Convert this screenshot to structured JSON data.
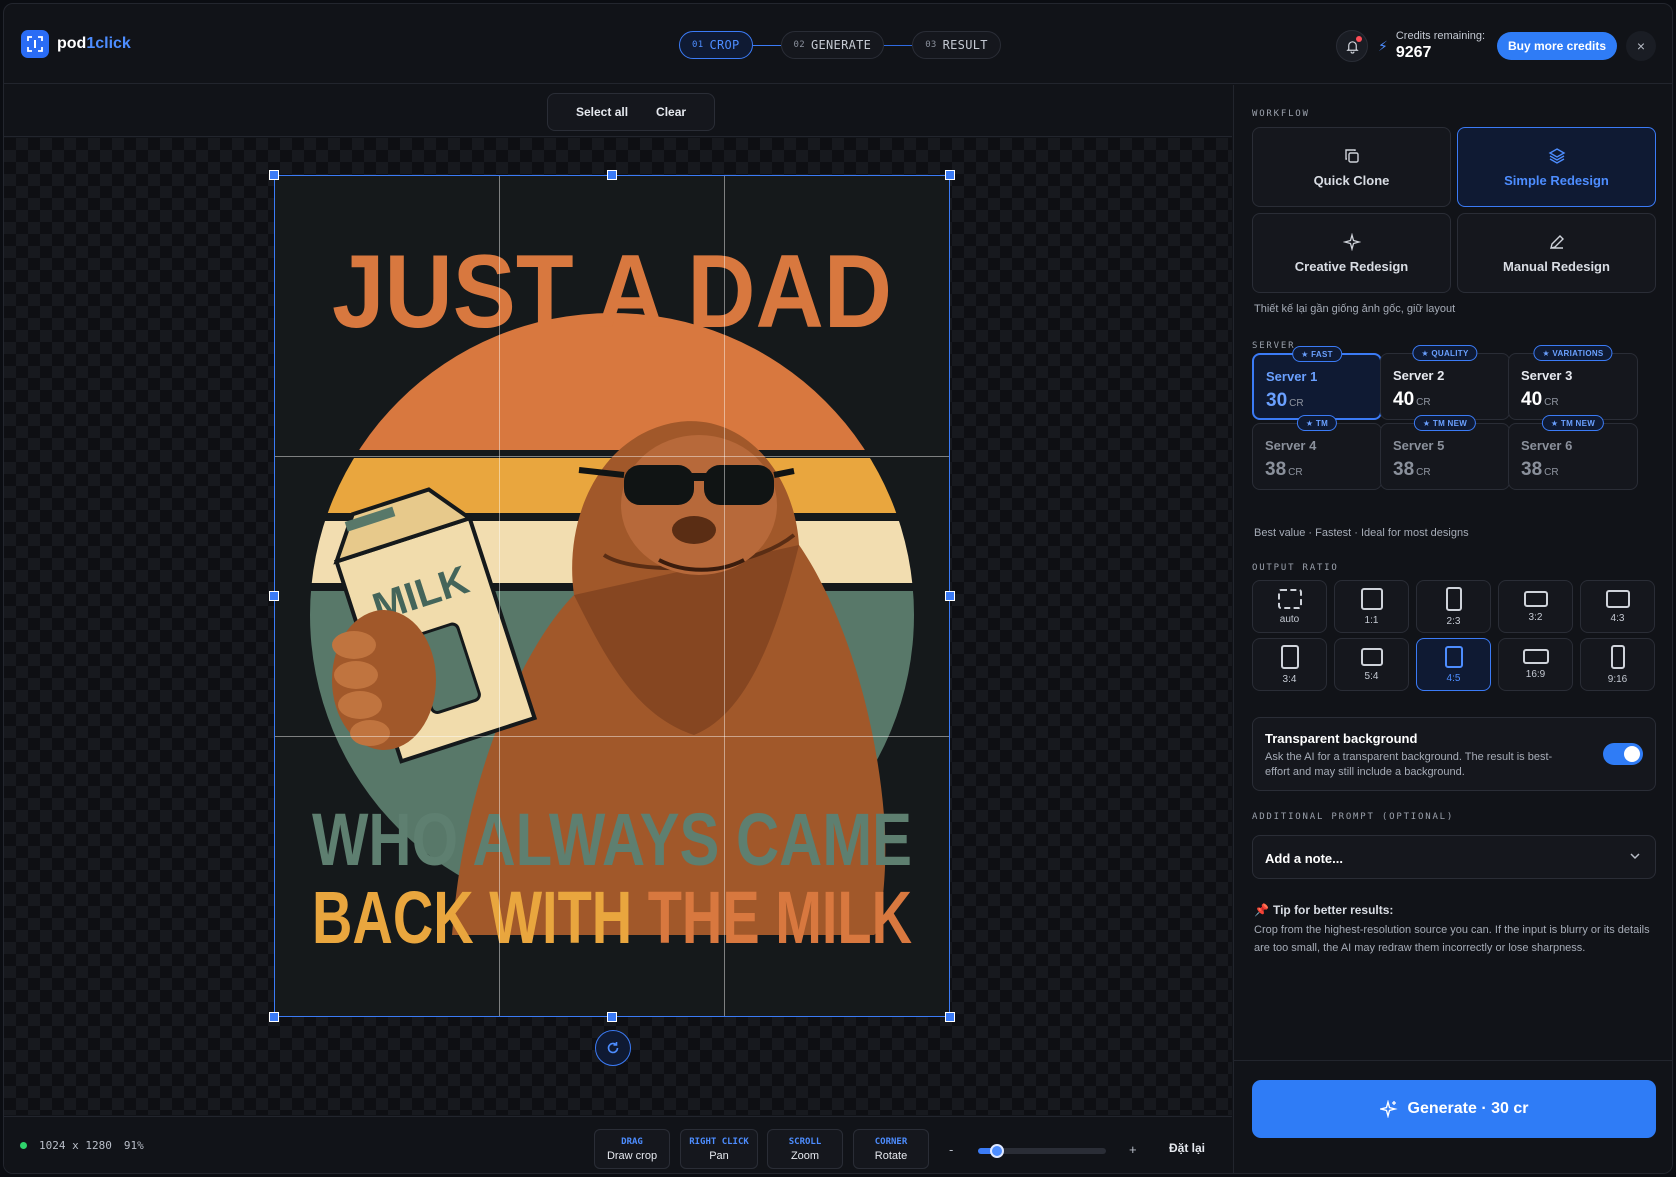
{
  "app": {
    "logo_part1": "pod",
    "logo_part2": "1click"
  },
  "steps": [
    {
      "num": "01",
      "label": "CROP",
      "active": true
    },
    {
      "num": "02",
      "label": "GENERATE",
      "active": false
    },
    {
      "num": "03",
      "label": "RESULT",
      "active": false
    }
  ],
  "header": {
    "credits_label": "Credits remaining:",
    "credits_value": "9267",
    "buy_label": "Buy more credits",
    "close_label": "×"
  },
  "canvas_toolbar": {
    "select_all": "Select all",
    "clear": "Clear"
  },
  "artwork": {
    "line1": "JUST A DAD",
    "line2": "WHO ALWAYS CAME",
    "line3a": "BACK WITH ",
    "line3b": "THE MILK",
    "carton_text": "MILK"
  },
  "bottom": {
    "dimensions": "1024 x 1280",
    "zoom": "91%",
    "hints": [
      {
        "key": "DRAG",
        "label": "Draw crop"
      },
      {
        "key": "RIGHT CLICK",
        "label": "Pan"
      },
      {
        "key": "SCROLL",
        "label": "Zoom"
      },
      {
        "key": "CORNER",
        "label": "Rotate"
      }
    ],
    "zoom_minus": "-",
    "zoom_plus": "+",
    "zoom_level": 0.15,
    "reset": "Đặt lại"
  },
  "panel": {
    "workflow_label": "WORKFLOW",
    "workflows": [
      {
        "label": "Quick Clone",
        "icon": "copy-icon",
        "active": false
      },
      {
        "label": "Simple Redesign",
        "icon": "layers-icon",
        "active": true
      },
      {
        "label": "Creative Redesign",
        "icon": "sparkle-icon",
        "active": false
      },
      {
        "label": "Manual Redesign",
        "icon": "pencil-icon",
        "active": false
      }
    ],
    "workflow_desc": "Thiết kế lại gần giống ảnh gốc, giữ layout",
    "server_label": "SERVER",
    "servers": [
      {
        "badge": "★ FAST",
        "name": "Server 1",
        "price": "30",
        "unit": "CR",
        "state": "active"
      },
      {
        "badge": "★ QUALITY",
        "name": "Server 2",
        "price": "40",
        "unit": "CR",
        "state": "normal"
      },
      {
        "badge": "★ VARIATIONS",
        "name": "Server 3",
        "price": "40",
        "unit": "CR",
        "state": "normal"
      },
      {
        "badge": "★ TM",
        "name": "Server 4",
        "price": "38",
        "unit": "CR",
        "state": "dim"
      },
      {
        "badge": "★ TM NEW",
        "name": "Server 5",
        "price": "38",
        "unit": "CR",
        "state": "dim"
      },
      {
        "badge": "★ TM NEW",
        "name": "Server 6",
        "price": "38",
        "unit": "CR",
        "state": "dim"
      }
    ],
    "server_desc": "Best value · Fastest · Ideal for most designs",
    "ratio_label": "OUTPUT RATIO",
    "ratios": [
      {
        "label": "auto",
        "active": false
      },
      {
        "label": "1:1",
        "active": false
      },
      {
        "label": "2:3",
        "active": false
      },
      {
        "label": "3:2",
        "active": false
      },
      {
        "label": "4:3",
        "active": false
      },
      {
        "label": "3:4",
        "active": false
      },
      {
        "label": "5:4",
        "active": false
      },
      {
        "label": "4:5",
        "active": true
      },
      {
        "label": "16:9",
        "active": false
      },
      {
        "label": "9:16",
        "active": false
      }
    ],
    "transparent_title": "Transparent background",
    "transparent_desc": "Ask the AI for a transparent background. The result is best-effort and may still include a background.",
    "transparent_on": true,
    "prompt_label": "ADDITIONAL PROMPT (OPTIONAL)",
    "prompt_placeholder": "Add a note...",
    "tip_title": "Tip for better results:",
    "tip_body": "Crop from the highest-resolution source you can. If the input is blurry or its details are too small, the AI may redraw them incorrectly or lose sharpness.",
    "generate_label": "Generate · 30 cr"
  }
}
